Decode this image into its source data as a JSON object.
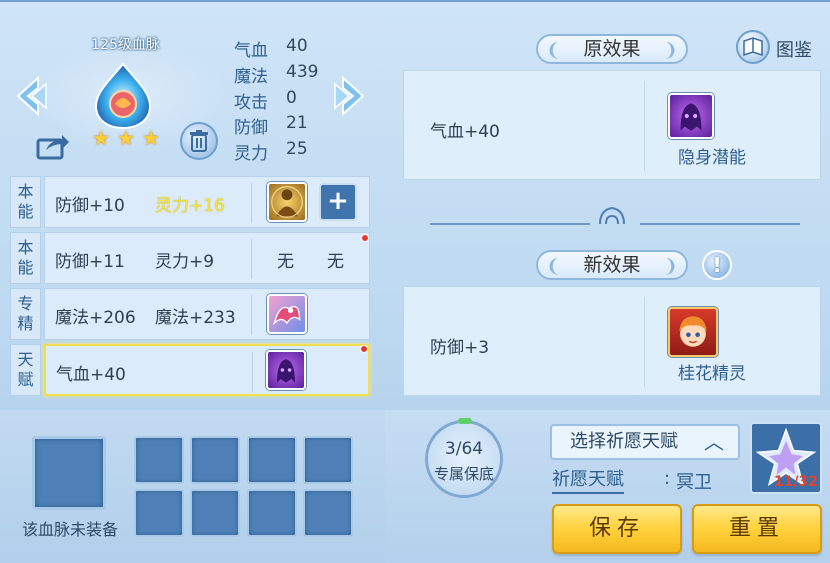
{
  "pet": {
    "blood_label": "125级血脉",
    "star_count": 3,
    "stats": [
      {
        "key": "气血",
        "value": "40"
      },
      {
        "key": "魔法",
        "value": "439"
      },
      {
        "key": "攻击",
        "value": "0"
      },
      {
        "key": "防御",
        "value": "21"
      },
      {
        "key": "灵力",
        "value": "25"
      }
    ]
  },
  "slots": [
    {
      "tag": "本能",
      "attr1": "防御+10",
      "attr2": "灵力+16",
      "attr2_highlight": true,
      "icon": "golden-buddha-icon",
      "action": "plus-icon",
      "red_dot": false
    },
    {
      "tag": "本能",
      "attr1": "防御+11",
      "attr2": "灵力+9",
      "attr2_highlight": false,
      "empty1": "无",
      "empty2": "无",
      "red_dot": true
    },
    {
      "tag": "专精",
      "attr1": "魔法+206",
      "attr2": "魔法+233",
      "attr2_highlight": false,
      "icon": "pink-dragon-icon",
      "red_dot": false
    },
    {
      "tag": "天赋",
      "attr1": "气血+40",
      "attr2": "",
      "attr2_highlight": false,
      "icon": "invisible-ghost-icon",
      "red_dot": true,
      "selected": true
    }
  ],
  "equipment": {
    "unequipped_text": "该血脉未装备",
    "grid_slots": 8
  },
  "original_effect": {
    "title": "原效果",
    "text": "气血+40",
    "skill_name": "隐身潜能",
    "skill_icon": "invisible-ghost-icon"
  },
  "new_effect": {
    "title": "新效果",
    "text": "防御+3",
    "skill_name": "桂花精灵",
    "skill_icon": "osmanthus-sprite-icon"
  },
  "codex": {
    "label": "图鉴"
  },
  "guarantee": {
    "count": "3/64",
    "label": "专属保底",
    "progress": 0.047
  },
  "wish": {
    "select_label": "选择祈愿天赋",
    "label": "祈愿天赋",
    "colon": ":",
    "value": "冥卫"
  },
  "crystal": {
    "count": "11/32"
  },
  "buttons": {
    "save": "保存",
    "reset": "重置"
  },
  "colors": {
    "panel_bg": "#cfe4f7",
    "accent_blue": "#2f5f8e",
    "highlight_yellow": "#f7e441",
    "gold_button": "#ffd23c",
    "red_dot": "#e23b2e"
  }
}
